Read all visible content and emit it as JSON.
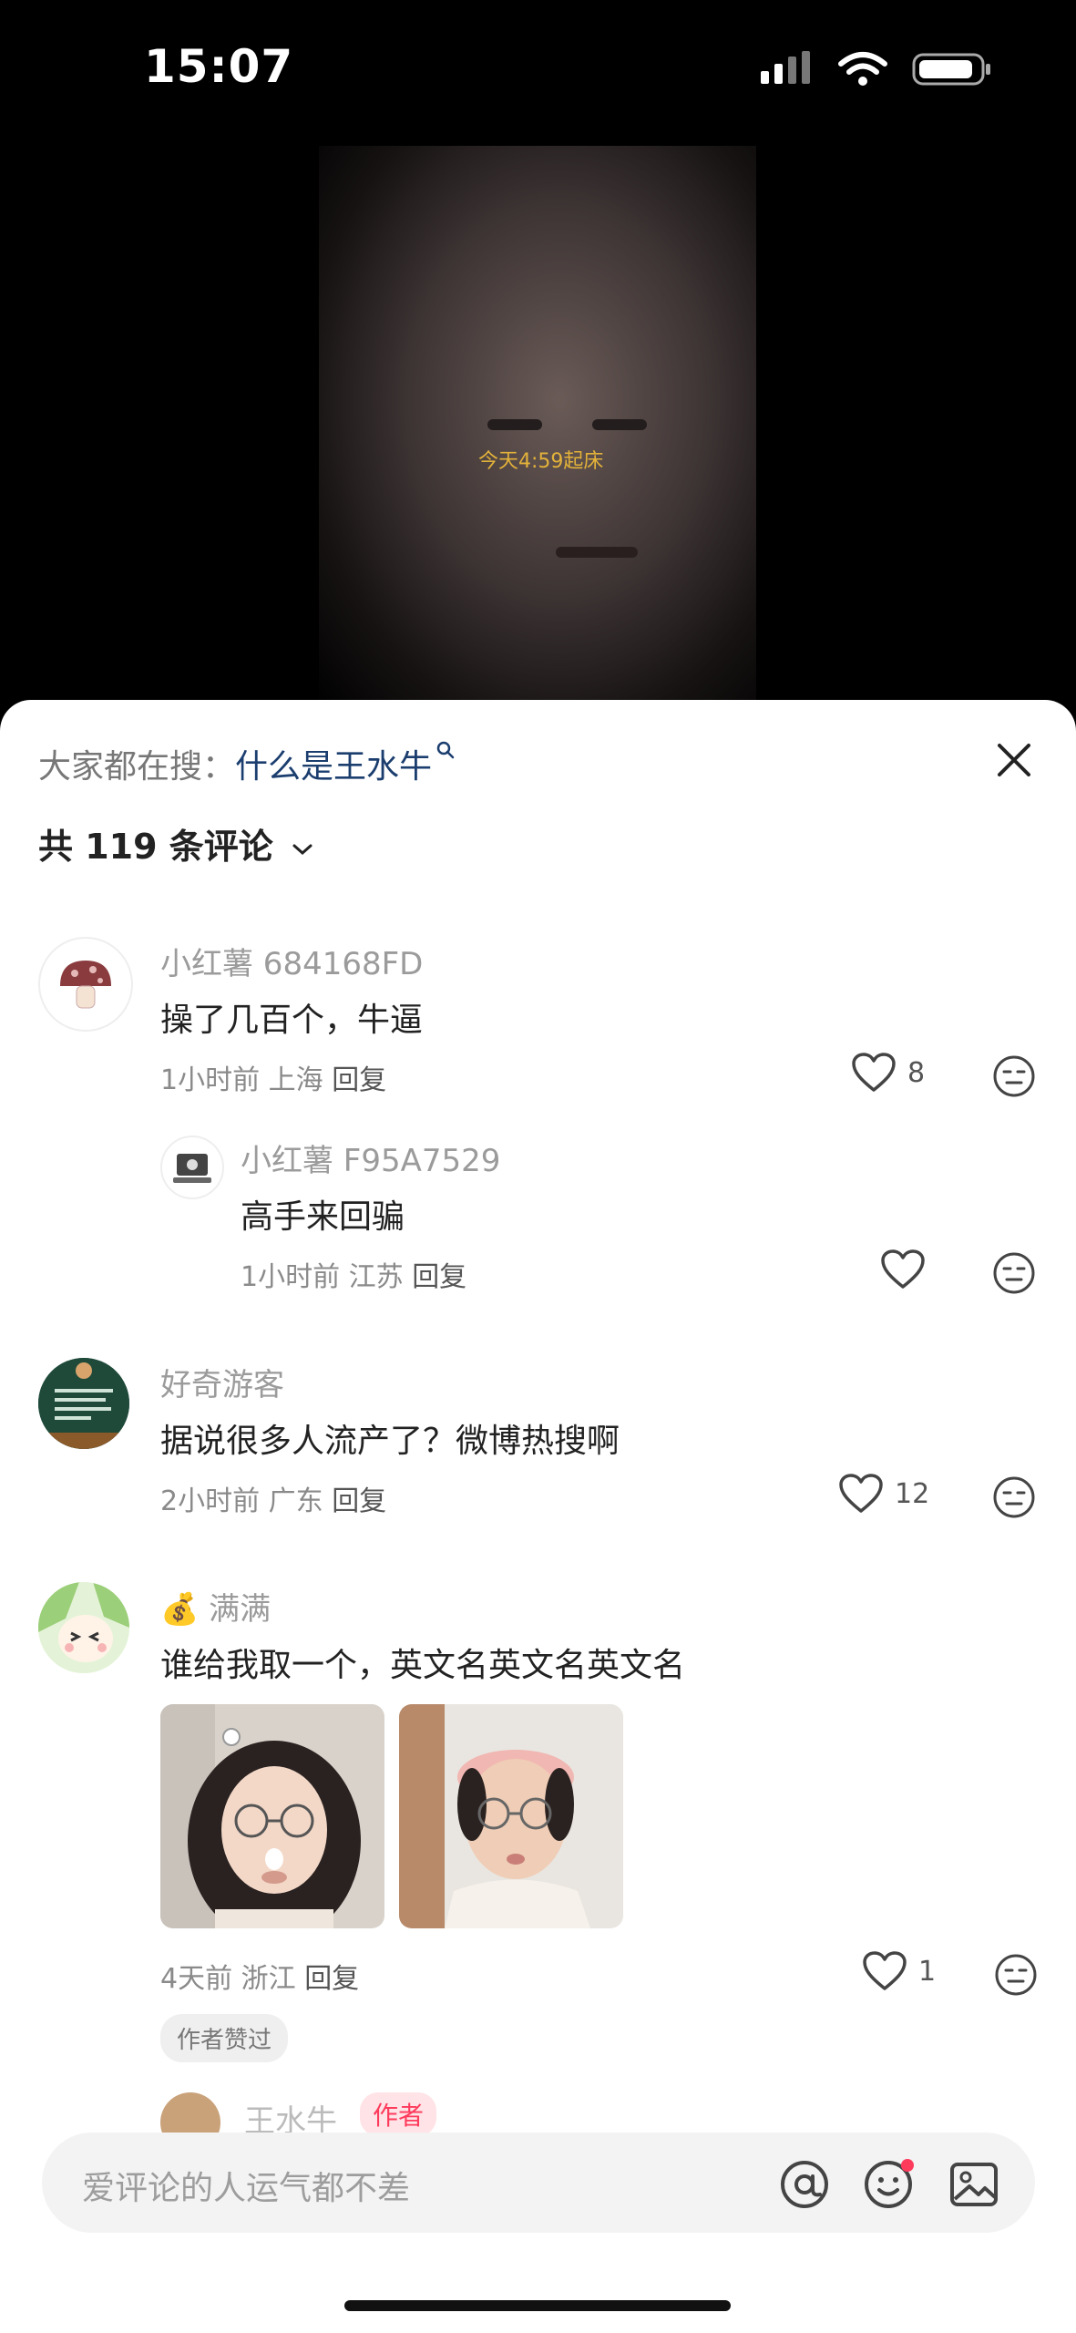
{
  "status_bar": {
    "time": "15:07"
  },
  "video": {
    "overlay_text": "今天4:59起床"
  },
  "sheet": {
    "search_prefix": "大家都在搜：",
    "search_keyword": "什么是王水牛",
    "comment_count": "共 119 条评论"
  },
  "comments": [
    {
      "name": "小红薯 684168FD",
      "text": "操了几百个，牛逼",
      "time": "1小时前",
      "location": "上海",
      "reply": "回复",
      "likes": "8"
    },
    {
      "name": "小红薯 F95A7529",
      "text": "高手来回骗",
      "time": "1小时前",
      "location": "江苏",
      "reply": "回复",
      "likes": ""
    },
    {
      "name": "好奇游客",
      "text": "据说很多人流产了？微博热搜啊",
      "time": "2小时前",
      "location": "广东",
      "reply": "回复",
      "likes": "12"
    },
    {
      "name": "满满",
      "name_emoji": "💰",
      "text": "谁给我取一个，英文名英文名英文名",
      "time": "4天前",
      "location": "浙江",
      "reply": "回复",
      "likes": "1",
      "badge": "作者赞过"
    }
  ],
  "peek": {
    "name": "王水牛",
    "badge": "作者"
  },
  "input": {
    "placeholder": "爱评论的人运气都不差"
  },
  "colors": {
    "keyword": "#1b3e6f",
    "accent_red": "#ff3b5c",
    "overlay_yellow": "#e3b23a"
  }
}
